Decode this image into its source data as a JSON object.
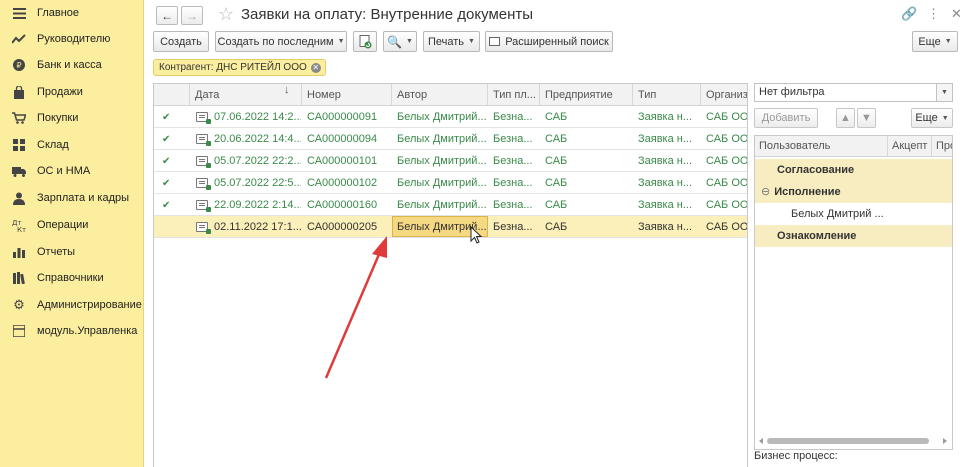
{
  "sidebar": {
    "items": [
      {
        "label": "Главное",
        "icon": "menu-icon"
      },
      {
        "label": "Руководителю",
        "icon": "trend-icon"
      },
      {
        "label": "Банк и касса",
        "icon": "coin-icon"
      },
      {
        "label": "Продажи",
        "icon": "bag-icon"
      },
      {
        "label": "Покупки",
        "icon": "cart-icon"
      },
      {
        "label": "Склад",
        "icon": "grid-icon"
      },
      {
        "label": "ОС и НМА",
        "icon": "truck-icon"
      },
      {
        "label": "Зарплата и кадры",
        "icon": "person-icon"
      },
      {
        "label": "Операции",
        "icon": "operations-icon"
      },
      {
        "label": "Отчеты",
        "icon": "report-icon"
      },
      {
        "label": "Справочники",
        "icon": "books-icon"
      },
      {
        "label": "Администрирование",
        "icon": "gear-icon"
      },
      {
        "label": "модуль.Управленка",
        "icon": "module-icon"
      }
    ]
  },
  "window": {
    "title": "Заявки на оплату: Внутренние документы"
  },
  "toolbar": {
    "create": "Создать",
    "create_by_last": "Создать по последним",
    "print": "Печать",
    "advanced_search": "Расширенный поиск",
    "more": "Еще"
  },
  "filter_chip": {
    "label": "Контрагент: ДНС РИТЕЙЛ ООО"
  },
  "table": {
    "columns": [
      "Дата",
      "Номер",
      "Автор",
      "Тип пл...",
      "Предприятие",
      "Тип",
      "Организа..."
    ],
    "rows": [
      {
        "date": "07.06.2022 14:2...",
        "number": "СА000000091",
        "author": "Белых Дмитрий...",
        "pay_type": "Безна...",
        "enterprise": "САБ",
        "type": "Заявка н...",
        "org": "САБ ООО...",
        "checked": true
      },
      {
        "date": "20.06.2022 14:4...",
        "number": "СА000000094",
        "author": "Белых Дмитрий...",
        "pay_type": "Безна...",
        "enterprise": "САБ",
        "type": "Заявка н...",
        "org": "САБ ООО...",
        "checked": true
      },
      {
        "date": "05.07.2022 22:2...",
        "number": "СА000000101",
        "author": "Белых Дмитрий...",
        "pay_type": "Безна...",
        "enterprise": "САБ",
        "type": "Заявка н...",
        "org": "САБ ООО...",
        "checked": true
      },
      {
        "date": "05.07.2022 22:5...",
        "number": "СА000000102",
        "author": "Белых Дмитрий...",
        "pay_type": "Безна...",
        "enterprise": "САБ",
        "type": "Заявка н...",
        "org": "САБ ООО...",
        "checked": true
      },
      {
        "date": "22.09.2022 2:14...",
        "number": "СА000000160",
        "author": "Белых Дмитрий...",
        "pay_type": "Безна...",
        "enterprise": "САБ",
        "type": "Заявка н...",
        "org": "САБ ООО...",
        "checked": true
      },
      {
        "date": "02.11.2022 17:1...",
        "number": "СА000000205",
        "author": "Белых Дмитрий...",
        "pay_type": "Безна...",
        "enterprise": "САБ",
        "type": "Заявка н...",
        "org": "САБ ООО",
        "checked": false,
        "selected": true
      }
    ]
  },
  "right_panel": {
    "filter_value": "Нет фильтра",
    "add": "Добавить",
    "more": "Еще",
    "columns": [
      "Пользователь",
      "Акцепт",
      "Про..."
    ],
    "rows": [
      {
        "label": "Согласование",
        "kind": "group"
      },
      {
        "label": "Исполнение",
        "kind": "group",
        "expanded": true
      },
      {
        "label": "Белых Дмитрий ...",
        "kind": "plain"
      },
      {
        "label": "Ознакомление",
        "kind": "group"
      }
    ],
    "business_process_label": "Бизнес процесс:"
  },
  "colors": {
    "sidebar_bg": "#fbee9e",
    "accent_green": "#3a8a4a",
    "selection": "#fbf0b9",
    "arrow": "#e03b3b"
  }
}
